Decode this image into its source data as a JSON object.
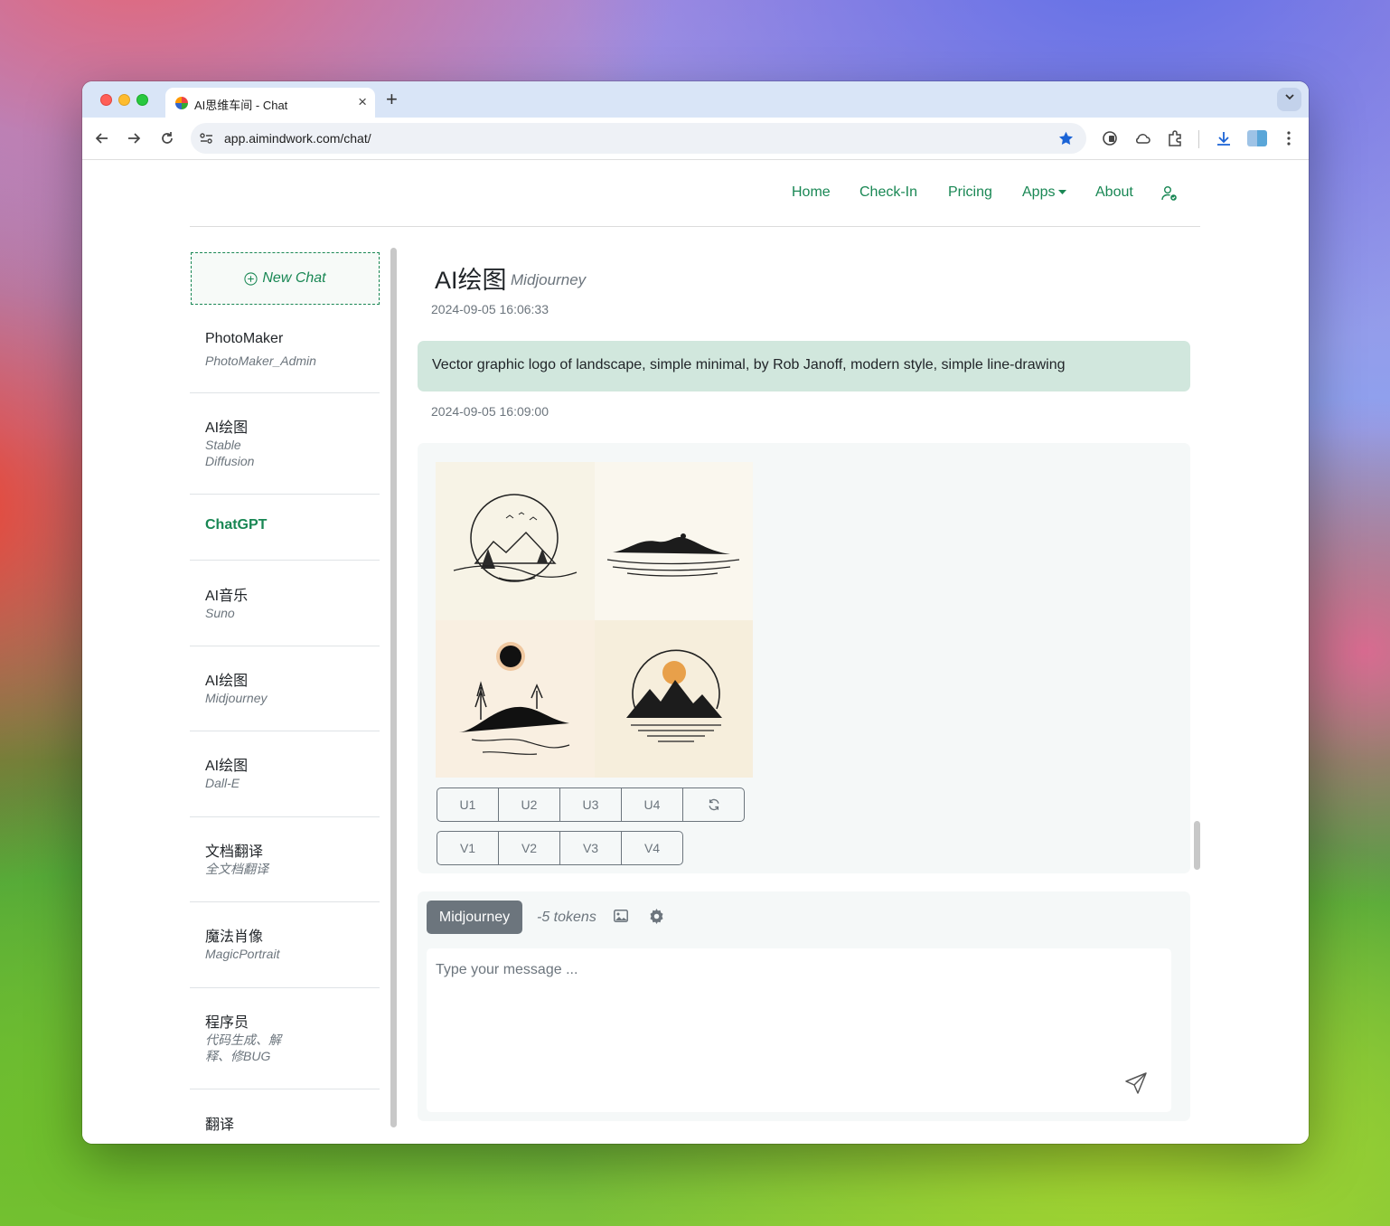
{
  "browser": {
    "tab_title": "AI思维车间 - Chat",
    "tab_close": "×",
    "new_tab": "+",
    "url": "app.aimindwork.com/chat/"
  },
  "nav": {
    "items": [
      {
        "label": "Home"
      },
      {
        "label": "Check-In"
      },
      {
        "label": "Pricing"
      },
      {
        "label": "Apps"
      },
      {
        "label": "About"
      }
    ]
  },
  "sidebar": {
    "new_chat_label": "New Chat",
    "items": [
      {
        "name": "PhotoMaker",
        "sub": "PhotoMaker_Admin"
      },
      {
        "name": "AI绘图",
        "sub": "Stable Diffusion"
      },
      {
        "name": "ChatGPT",
        "sub": ""
      },
      {
        "name": "AI音乐",
        "sub": "Suno"
      },
      {
        "name": "AI绘图",
        "sub": "Midjourney"
      },
      {
        "name": "AI绘图",
        "sub": "Dall-E"
      },
      {
        "name": "文档翻译",
        "sub": "全文档翻译"
      },
      {
        "name": "魔法肖像",
        "sub": "MagicPortrait"
      },
      {
        "name": "程序员",
        "sub": "代码生成、解释、修BUG"
      },
      {
        "name": "翻译",
        "sub": ""
      }
    ]
  },
  "chat": {
    "title": "AI绘图",
    "subtitle": "Midjourney",
    "created_at": "2024-09-05 16:06:33",
    "user_message": "Vector graphic logo of landscape, simple minimal, by Rob Janoff, modern style, simple line-drawing",
    "response_time": "2024-09-05 16:09:00",
    "upscale_buttons": [
      "U1",
      "U2",
      "U3",
      "U4"
    ],
    "variation_buttons": [
      "V1",
      "V2",
      "V3",
      "V4"
    ]
  },
  "composer": {
    "model": "Midjourney",
    "tokens": "-5 tokens",
    "placeholder": "Type your message ..."
  },
  "colors": {
    "accent": "#198754",
    "user_bubble": "#d1e7dd",
    "secondary": "#6c757d"
  }
}
